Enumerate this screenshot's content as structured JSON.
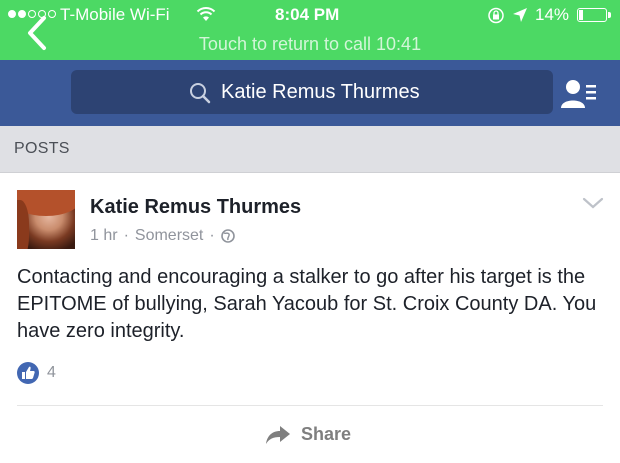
{
  "status_bar": {
    "carrier": "T-Mobile Wi-Fi",
    "time": "8:04 PM",
    "battery": "14%",
    "battery_level": 0.14,
    "signal_bars_filled": 2,
    "signal_bars_total": 5
  },
  "call_banner": {
    "text": "Touch to return to call",
    "duration": "10:41"
  },
  "nav": {
    "search_value": "Katie Remus Thurmes"
  },
  "section": {
    "label": "POSTS"
  },
  "post": {
    "author": "Katie Remus Thurmes",
    "time": "1 hr",
    "location": "Somerset",
    "text": "Contacting and encouraging a stalker to go after his target is the EPITOME of bullying, Sarah Yacoub for St. Croix County DA.  You have zero integrity.",
    "like_count": "4",
    "share_label": "Share"
  },
  "colors": {
    "status_green": "#4cd964",
    "facebook_blue": "#3b5998",
    "search_bg": "#2d4373",
    "section_bg": "#dfe0e4",
    "like_blue": "#4267b2"
  },
  "icons": [
    "wifi-icon",
    "rotation-lock-icon",
    "location-arrow-icon",
    "battery-icon",
    "back-chevron-icon",
    "search-icon",
    "friend-requests-icon",
    "chevron-down-icon",
    "globe-icon",
    "like-icon",
    "share-arrow-icon"
  ]
}
